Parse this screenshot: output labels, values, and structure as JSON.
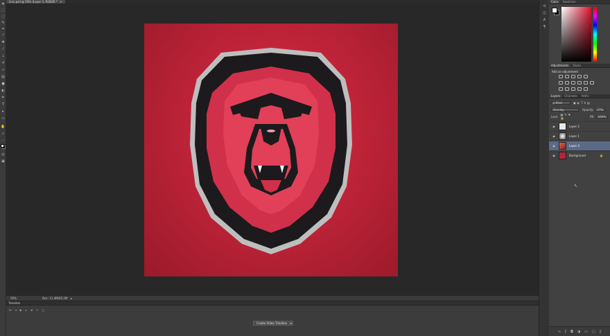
{
  "document": {
    "tab_title": "Lion.psd @ 50% (Layer 3, RGB/8) *",
    "close_symbol": "×"
  },
  "toolbar": {
    "tools": [
      "move-tool",
      "marquee-tool",
      "lasso-tool",
      "quick-select-tool",
      "crop-tool",
      "eyedropper-tool",
      "healing-tool",
      "brush-tool",
      "stamp-tool",
      "history-brush-tool",
      "eraser-tool",
      "gradient-tool",
      "blur-tool",
      "dodge-tool",
      "pen-tool",
      "type-tool",
      "path-select-tool",
      "shape-tool",
      "hand-tool",
      "zoom-tool",
      "color-swatches",
      "quick-mask-tool",
      "screen-mode-tool"
    ]
  },
  "status_bar": {
    "zoom": "50%",
    "doc_info": "Doc: 11.4M/45.2M",
    "arrow": "▸"
  },
  "timeline": {
    "title": "Timeline",
    "controls": [
      "⏮",
      "◂",
      "▶",
      "▸",
      "◂)",
      "✂",
      "◻"
    ],
    "create_button": "Create Video Timeline",
    "dropdown_arrow": "▾"
  },
  "color_panel": {
    "tabs": [
      "Color",
      "Swatches"
    ],
    "foreground": "#ffffff",
    "background": "#000000",
    "current_hue": "#e0122f"
  },
  "adjustments_panel": {
    "tabs": [
      "Adjustments",
      "Styles"
    ],
    "title": "Add an adjustment"
  },
  "layers_panel": {
    "tabs": [
      "Layers",
      "Channels",
      "Paths"
    ],
    "filter_label": "ρ Kind",
    "blend_mode": "Overlay",
    "opacity_label": "Opacity:",
    "opacity_value": "27%",
    "lock_label": "Lock:",
    "fill_label": "Fill:",
    "fill_value": "100%",
    "layers": [
      {
        "name": "Layer 2",
        "selected": false,
        "thumb": "#e8e8e8"
      },
      {
        "name": "Layer 1",
        "selected": false,
        "thumb": "radial"
      },
      {
        "name": "Layer 3",
        "selected": true,
        "thumb": "#c4432a"
      },
      {
        "name": "Background",
        "selected": false,
        "thumb": "#b8233a",
        "locked": true
      }
    ],
    "footer_icons": [
      "link-icon",
      "fx-icon",
      "mask-icon",
      "adjustment-icon",
      "folder-icon",
      "new-layer-icon",
      "trash-icon"
    ]
  },
  "artwork": {
    "background_color": "#c2243a",
    "outline_color": "#1c1a1c",
    "face_color": "#e03650",
    "rim_color": "#bebebe"
  }
}
